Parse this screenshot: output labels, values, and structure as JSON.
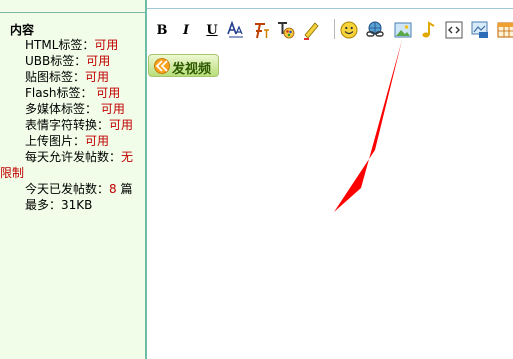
{
  "sidebar": {
    "title": "内容",
    "items": [
      {
        "label": "HTML标签：",
        "value": "可用"
      },
      {
        "label": "UBB标签：",
        "value": "可用"
      },
      {
        "label": "贴图标签：",
        "value": "可用"
      },
      {
        "label": "Flash标签： ",
        "value": "可用"
      },
      {
        "label": "多媒体标签： ",
        "value": "可用"
      },
      {
        "label": "表情字符转换：",
        "value": "可用"
      },
      {
        "label": "上传图片：",
        "value": "可用"
      },
      {
        "label": "每天允许发帖数：",
        "value": "无",
        "value_cont": "限制"
      },
      {
        "label": "今天已发帖数：",
        "value": "8",
        "unit": " 篇"
      },
      {
        "label": "最多：31KB"
      }
    ]
  },
  "toolbar": {
    "bold": "B",
    "italic": "I",
    "underline": "U",
    "icons": [
      "bold-icon",
      "italic-icon",
      "underline-icon",
      "font-size-icon",
      "font-face-icon",
      "text-color-icon",
      "highlight-icon",
      "emoticon-icon",
      "link-icon",
      "image-icon",
      "music-icon",
      "code-icon",
      "picture-upload-icon",
      "table-icon"
    ]
  },
  "video_button": {
    "label": "发视频"
  },
  "colors": {
    "sidebar_bg": "#f1fde8",
    "value_red": "#c00000",
    "divider": "#6dbda6",
    "annotation_arrow": "#ff0000"
  }
}
